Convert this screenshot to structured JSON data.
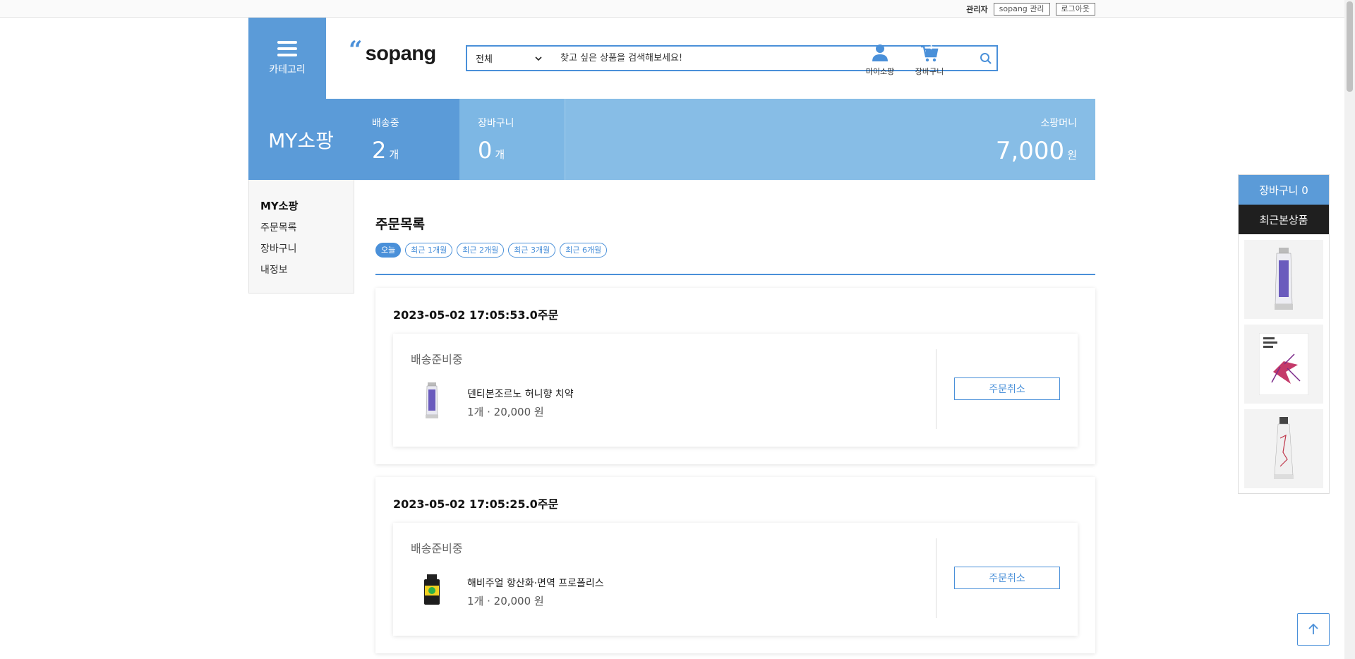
{
  "topbar": {
    "role": "관리자",
    "admin_button": "sopang 관리",
    "logout_button": "로그아웃"
  },
  "header": {
    "category_label": "카테고리",
    "logo_text": "sopang",
    "search": {
      "category_selected": "전체",
      "placeholder": "찾고 싶은 상품을 검색해보세요!"
    },
    "mypage_label": "마이소팡",
    "cart_label": "장바구니"
  },
  "summary": {
    "title": "MY소팡",
    "shipping_caption": "배송중",
    "shipping_count": "2",
    "cart_caption": "장바구니",
    "cart_count": "0",
    "count_unit": "개",
    "money_caption": "소팡머니",
    "money_value": "7,000",
    "money_unit": "원"
  },
  "sidebar": {
    "heading": "MY소팡",
    "items": [
      {
        "label": "주문목록"
      },
      {
        "label": "장바구니"
      },
      {
        "label": "내정보"
      }
    ]
  },
  "orders_section": {
    "title": "주문목록",
    "periods": [
      {
        "label": "오늘",
        "active": true
      },
      {
        "label": "최근 1개월",
        "active": false
      },
      {
        "label": "최근 2개월",
        "active": false
      },
      {
        "label": "최근 3개월",
        "active": false
      },
      {
        "label": "최근 6개월",
        "active": false
      }
    ]
  },
  "orders": [
    {
      "date": "2023-05-02 17:05:53.0주문",
      "status": "배송준비중",
      "product_name": "덴티본조르노 허니향 치약",
      "product_detail": "1개 · 20,000 원",
      "cancel_label": "주문취소"
    },
    {
      "date": "2023-05-02 17:05:25.0주문",
      "status": "배송준비중",
      "product_name": "해비주얼 항산화·면역 프로폴리스",
      "product_detail": "1개 · 20,000 원",
      "cancel_label": "주문취소"
    }
  ],
  "recent_panel": {
    "cart_label": "장바구니 0",
    "title": "최근본상품"
  },
  "colors": {
    "accent": "#4a90d9",
    "primary_block": "#5b9bd8",
    "light_block": "#87bde6"
  }
}
